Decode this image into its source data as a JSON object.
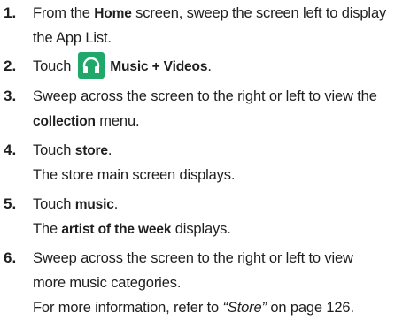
{
  "steps": [
    {
      "number": "1.",
      "text": {
        "a": "From the ",
        "b": "Home",
        "c": " screen, sweep the screen left to display",
        "d": "the App List."
      }
    },
    {
      "number": "2.",
      "text": {
        "a": "Touch",
        "icon": "headphones-icon",
        "b": "Music + Videos",
        "c": "."
      }
    },
    {
      "number": "3.",
      "text": {
        "a": "Sweep across the screen to the right or left to view the",
        "b": "collection",
        "c": " menu."
      }
    },
    {
      "number": "4.",
      "text": {
        "a": "Touch ",
        "b": "store",
        "c": ".",
        "d": "The store main screen displays."
      }
    },
    {
      "number": "5.",
      "text": {
        "a": "Touch ",
        "b": "music",
        "c": ".",
        "d": "The ",
        "e": "artist of the week",
        "f": " displays."
      }
    },
    {
      "number": "6.",
      "text": {
        "a": "Sweep across the screen to the right or left to view",
        "b": "more music categories.",
        "c": "For more information, refer to ",
        "d": "“Store”",
        "e": " on page 126."
      }
    }
  ],
  "colors": {
    "icon_bg": "#1fa86a",
    "text": "#1f1f1f"
  }
}
